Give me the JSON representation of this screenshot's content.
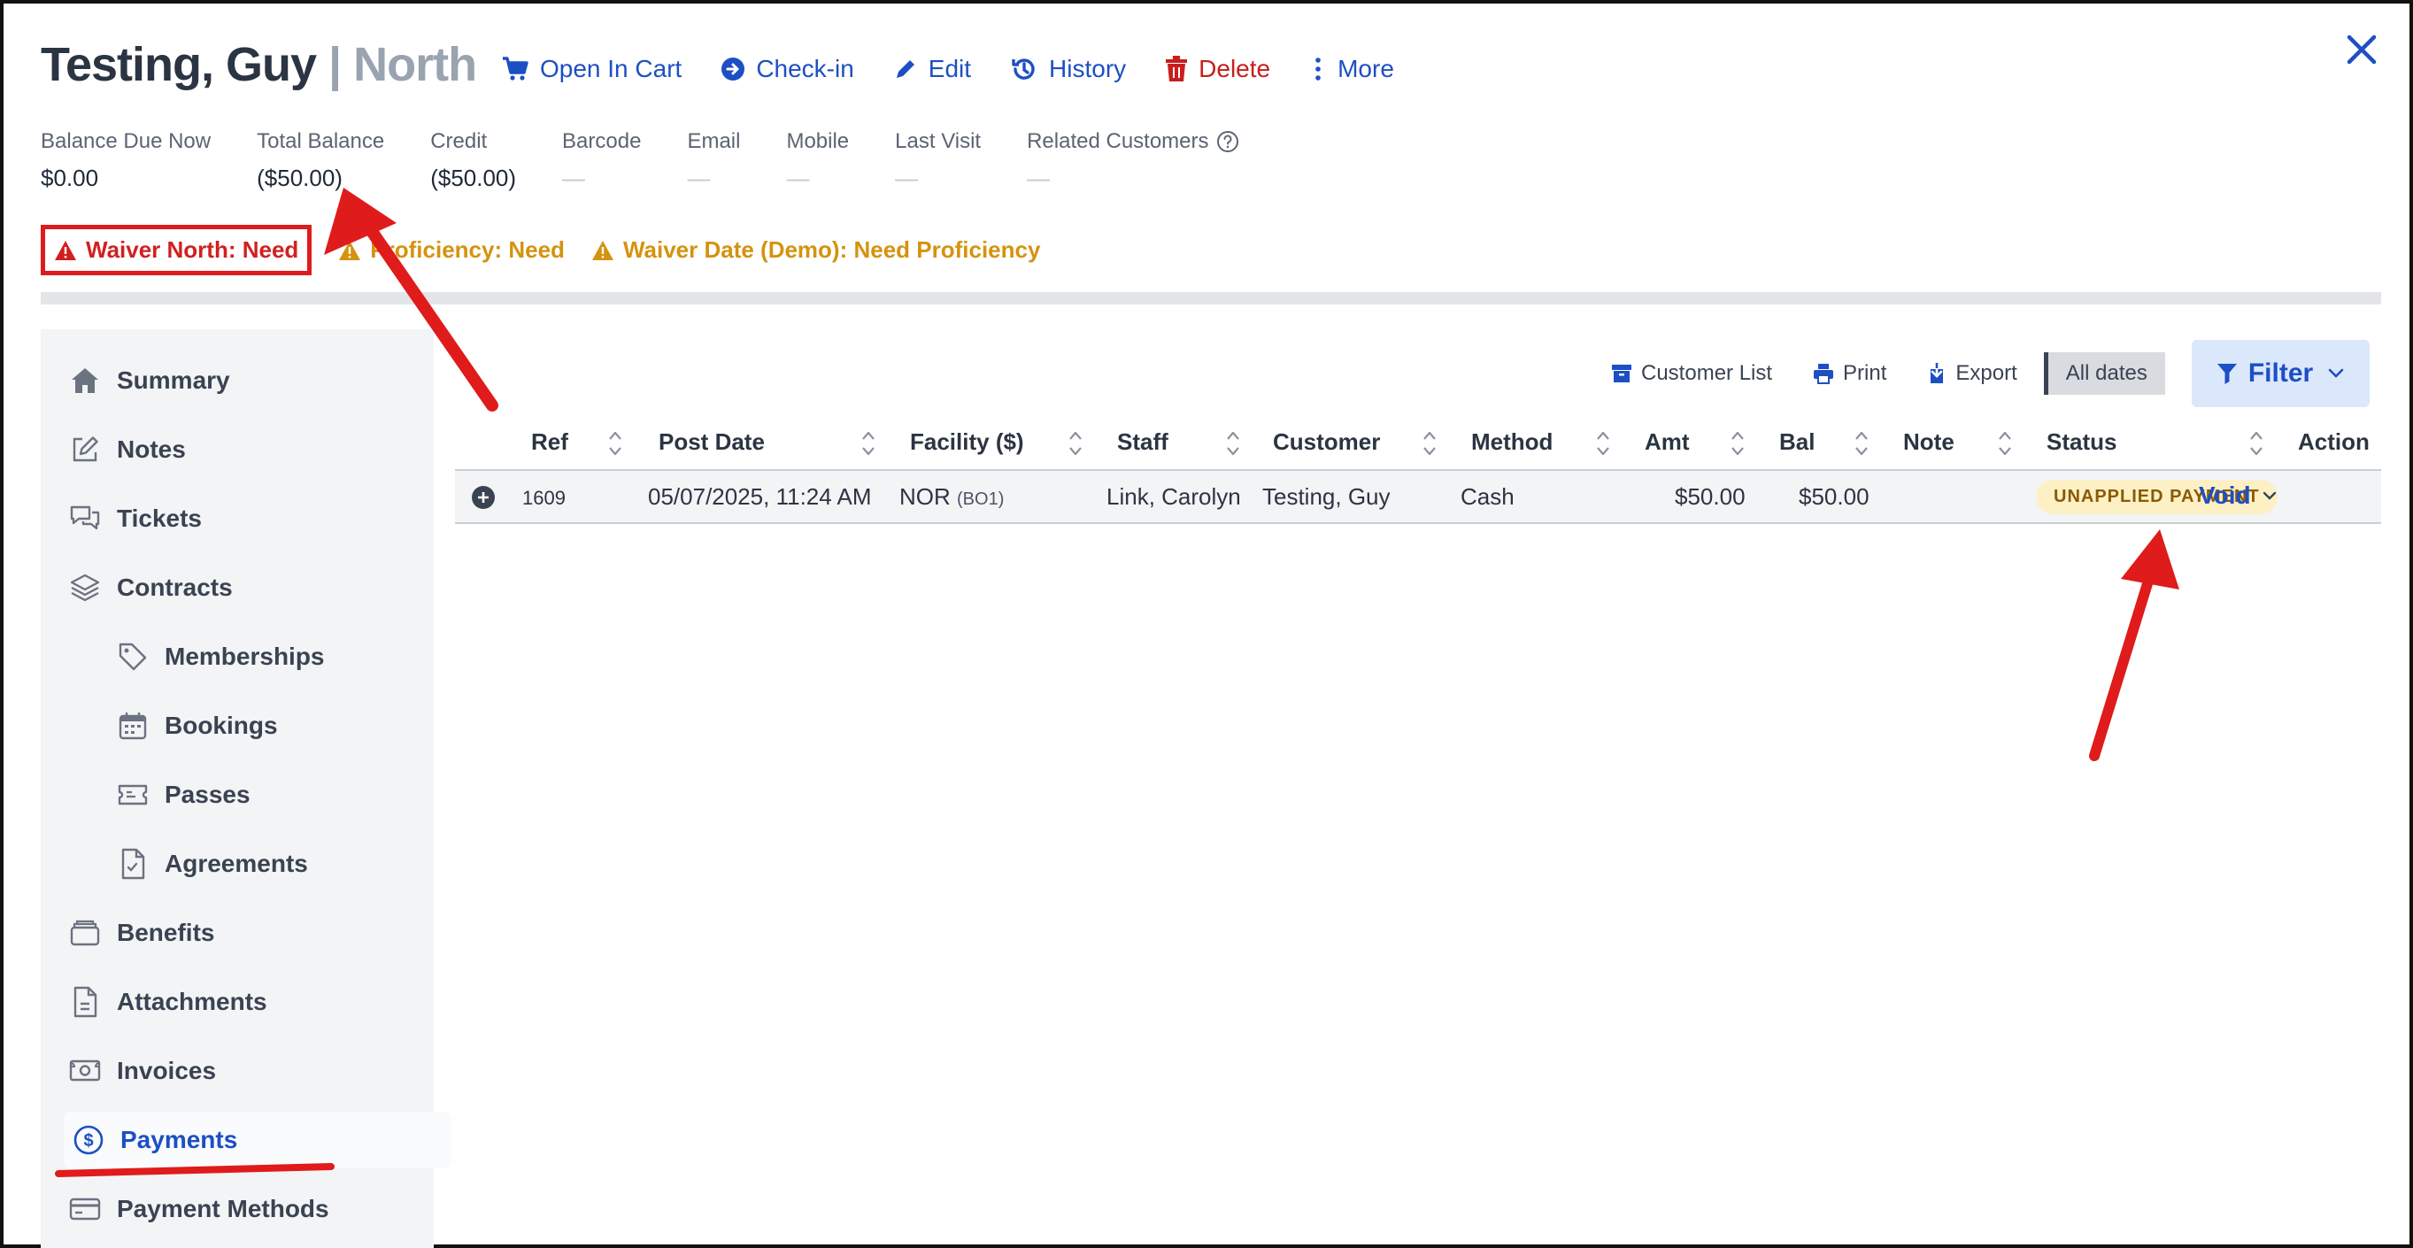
{
  "header": {
    "name": "Testing, Guy",
    "separator": "|",
    "location": "North"
  },
  "actions": {
    "open_in_cart": "Open In Cart",
    "check_in": "Check-in",
    "edit": "Edit",
    "history": "History",
    "delete": "Delete",
    "more": "More"
  },
  "stats": {
    "balance_due_now": {
      "label": "Balance Due Now",
      "value": "$0.00"
    },
    "total_balance": {
      "label": "Total Balance",
      "value": "($50.00)"
    },
    "credit": {
      "label": "Credit",
      "value": "($50.00)"
    },
    "barcode": {
      "label": "Barcode",
      "value": "—"
    },
    "email": {
      "label": "Email",
      "value": "—"
    },
    "mobile": {
      "label": "Mobile",
      "value": "—"
    },
    "last_visit": {
      "label": "Last Visit",
      "value": "—"
    },
    "related_customers": {
      "label": "Related Customers",
      "value": "—"
    }
  },
  "alerts": {
    "waiver_north": "Waiver North: Need",
    "proficiency": "Proficiency: Need",
    "waiver_date": "Waiver Date (Demo): Need Proficiency"
  },
  "sidebar": {
    "items": [
      {
        "label": "Summary",
        "icon": "home-icon"
      },
      {
        "label": "Notes",
        "icon": "pencil-square-icon"
      },
      {
        "label": "Tickets",
        "icon": "chat-bubbles-icon"
      },
      {
        "label": "Contracts",
        "icon": "layers-icon"
      },
      {
        "label": "Memberships",
        "icon": "tag-icon"
      },
      {
        "label": "Bookings",
        "icon": "calendar-icon"
      },
      {
        "label": "Passes",
        "icon": "ticket-icon"
      },
      {
        "label": "Agreements",
        "icon": "document-check-icon"
      },
      {
        "label": "Benefits",
        "icon": "wallet-icon"
      },
      {
        "label": "Attachments",
        "icon": "document-icon"
      },
      {
        "label": "Invoices",
        "icon": "cash-icon"
      },
      {
        "label": "Payments",
        "icon": "dollar-circle-icon"
      },
      {
        "label": "Payment Methods",
        "icon": "credit-card-icon"
      }
    ],
    "active": "Payments"
  },
  "toolbar": {
    "customer_list": "Customer List",
    "print": "Print",
    "export": "Export",
    "dates": "All dates",
    "filter": "Filter"
  },
  "table": {
    "columns": [
      "Ref",
      "Post Date",
      "Facility ($)",
      "Staff",
      "Customer",
      "Method",
      "Amt",
      "Bal",
      "Note",
      "Status",
      "Action"
    ],
    "rows": [
      {
        "ref": "1609",
        "post_date": "05/07/2025, 11:24 AM",
        "facility": "NOR",
        "facility_code": "(BO1)",
        "staff": "Link, Carolyn",
        "customer": "Testing, Guy",
        "method": "Cash",
        "amt": "$50.00",
        "bal": "$50.00",
        "note": "",
        "status": "UNAPPLIED PAYMENT",
        "action": "Void"
      }
    ]
  },
  "colors": {
    "accent": "#1d4fc4",
    "danger": "#c81e1e",
    "warning": "#d4930f",
    "annotation": "#e01b1b"
  }
}
